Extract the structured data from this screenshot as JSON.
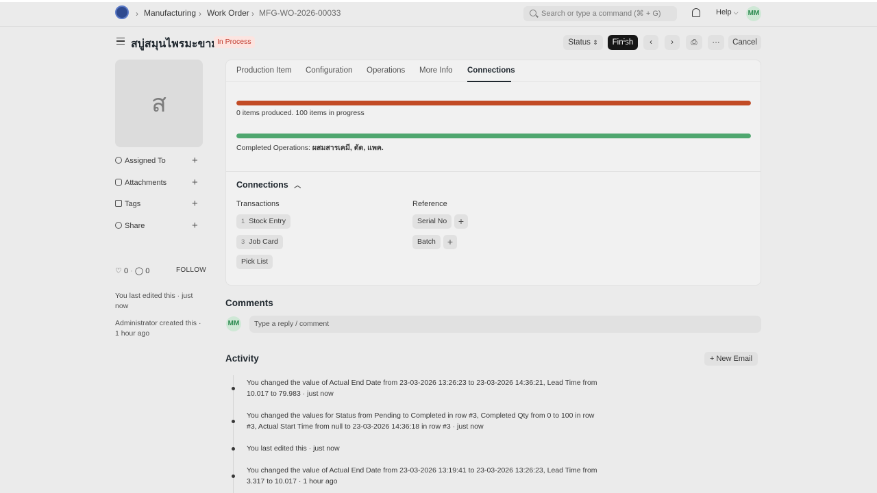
{
  "breadcrumb": {
    "items": [
      "Manufacturing",
      "Work Order",
      "MFG-WO-2026-00033"
    ]
  },
  "search": {
    "placeholder": "Search or type a command (⌘ + G)"
  },
  "navbar": {
    "help_label": "Help",
    "avatar_initials": "MM"
  },
  "doc": {
    "title": "สบู่สมุนไพรมะขาม",
    "status": "In Process",
    "status_color": "#c0392b"
  },
  "actions": {
    "status_label": "Status",
    "finish_label": "Finish",
    "cancel_label": "Cancel"
  },
  "sidebar": {
    "image_letter": "ส",
    "items": [
      {
        "label": "Assigned To",
        "icon": "user-icon"
      },
      {
        "label": "Attachments",
        "icon": "paperclip-icon"
      },
      {
        "label": "Tags",
        "icon": "tag-icon"
      },
      {
        "label": "Share",
        "icon": "share-icon"
      }
    ],
    "likes": "0",
    "comments": "0",
    "follow_label": "FOLLOW",
    "last_edited": "You last edited this · just now",
    "created": "Administrator created this · 1 hour ago"
  },
  "tabs": [
    "Production Item",
    "Configuration",
    "Operations",
    "More Info",
    "Connections"
  ],
  "progress": {
    "produced_text": "0 items produced. 100 items in progress",
    "produced_color": "#c24b25",
    "produced_fraction": 1.0,
    "operations_text_prefix": "Completed Operations: ",
    "operations_list": "ผสมสารเคมี, ตัด, แพค.",
    "operations_color": "#4fa76f",
    "operations_fraction": 1.0
  },
  "connections": {
    "title": "Connections",
    "transactions_label": "Transactions",
    "reference_label": "Reference",
    "transactions": [
      {
        "count": "1",
        "label": "Stock Entry"
      },
      {
        "count": "3",
        "label": "Job Card"
      },
      {
        "count": "",
        "label": "Pick List"
      }
    ],
    "references": [
      {
        "label": "Serial No"
      },
      {
        "label": "Batch"
      }
    ]
  },
  "comments": {
    "title": "Comments",
    "avatar_initials": "MM",
    "placeholder": "Type a reply / comment"
  },
  "activity": {
    "title": "Activity",
    "new_email_label": "+ New Email",
    "entries": [
      "You changed the value of Actual End Date from 23-03-2026 13:26:23 to 23-03-2026 14:36:21, Lead Time from 10.017 to 79.983 · just now",
      "You changed the values for Status from Pending to Completed in row #3, Completed Qty from 0 to 100 in row #3, Actual Start Time from null to 23-03-2026 14:36:18 in row #3 · just now",
      "You last edited this · just now",
      "You changed the value of Actual End Date from 23-03-2026 13:19:41 to 23-03-2026 13:26:23, Lead Time from 3.317 to 10.017 · 1 hour ago"
    ]
  }
}
